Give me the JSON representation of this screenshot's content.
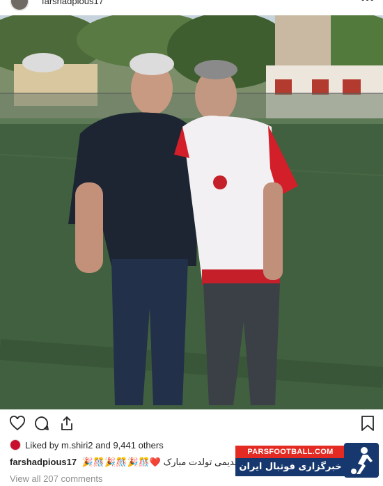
{
  "header": {
    "username": "farshadpious17",
    "more_icon": "more-horizontal-icon"
  },
  "post": {
    "image_description_icon": "photo",
    "actions": {
      "like_icon": "heart-outline-icon",
      "comment_icon": "comment-bubble-icon",
      "share_icon": "share-upload-icon",
      "save_icon": "bookmark-icon"
    },
    "likes_text": "Liked by m.shiri2 and 9,441 others",
    "caption_username": "farshadpious17",
    "caption_text": "مجتبی عزیز یار قدیمی تولدت مبارک ❤️🎊🎉🎊🎉🎊🎉",
    "view_comments": "View all 207 comments"
  },
  "watermark": {
    "site": "PARSFOOTBALL.COM",
    "tagline": "خبرگزاری فوتبال ایران"
  },
  "colors": {
    "watermark_red": "#e32b23",
    "watermark_navy": "#17386e",
    "muted_text": "#8e8e8e"
  }
}
